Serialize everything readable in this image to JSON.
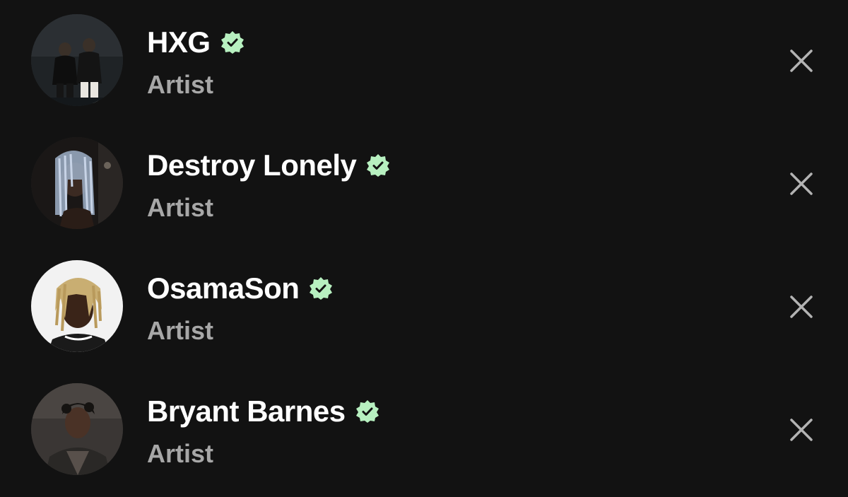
{
  "recent_searches": [
    {
      "name": "HXG",
      "subtitle": "Artist",
      "verified": true,
      "avatar_icon": "artist-photo"
    },
    {
      "name": "Destroy Lonely",
      "subtitle": "Artist",
      "verified": true,
      "avatar_icon": "artist-photo"
    },
    {
      "name": "OsamaSon",
      "subtitle": "Artist",
      "verified": true,
      "avatar_icon": "artist-photo"
    },
    {
      "name": "Bryant Barnes",
      "subtitle": "Artist",
      "verified": true,
      "avatar_icon": "artist-photo"
    }
  ],
  "icons": {
    "verified": "verified-badge-icon",
    "remove": "close-icon"
  },
  "colors": {
    "background": "#121212",
    "title": "#ffffff",
    "subtitle": "#a7a7a7",
    "verified_badge": "#b7f0c0",
    "remove_icon": "#b3b3b3"
  }
}
